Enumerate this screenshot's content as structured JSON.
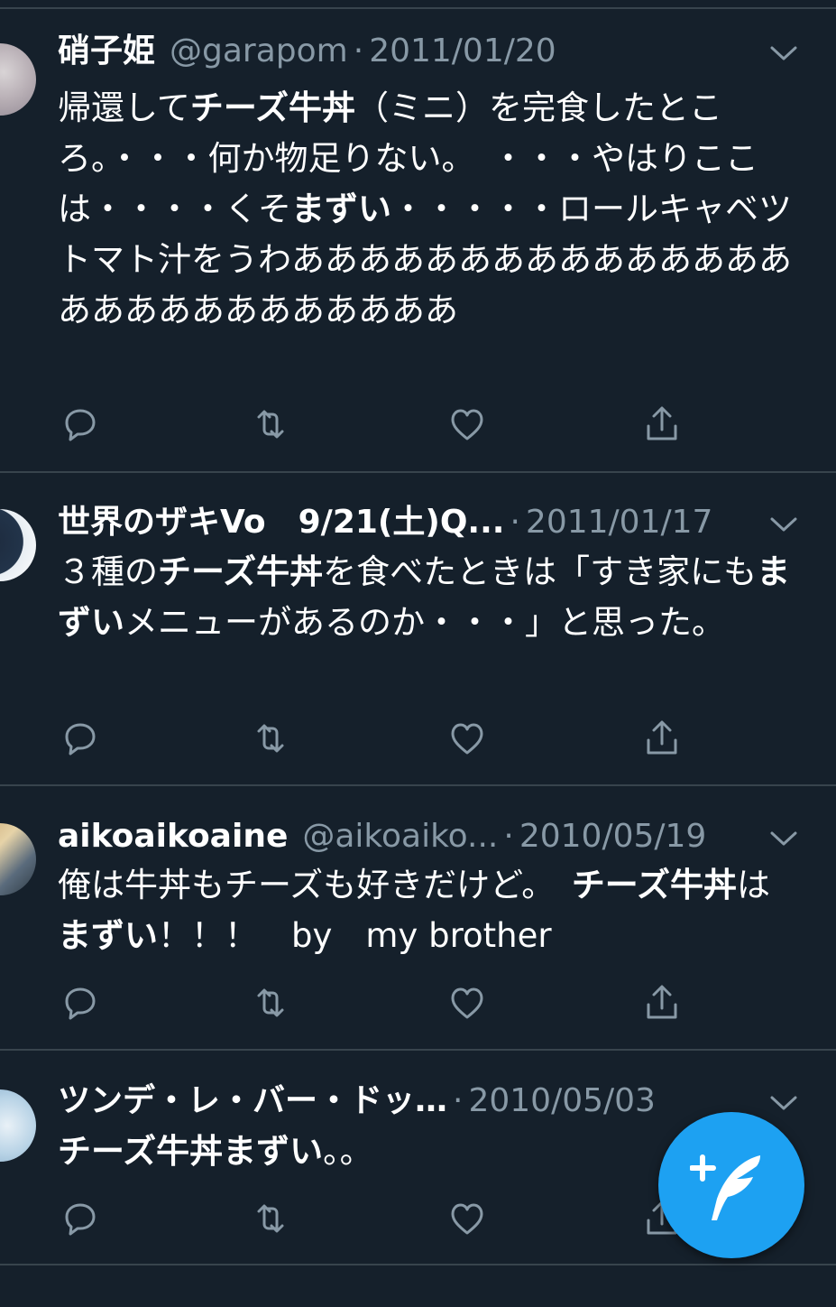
{
  "tweets": [
    {
      "name": "硝子姫",
      "handle": "@garapom",
      "date": "2011/01/20",
      "segments": [
        {
          "t": "帰還して",
          "b": false
        },
        {
          "t": "チーズ牛丼",
          "b": true
        },
        {
          "t": "（ミニ）を完食したところ。・・・何か物足りない。　・・・やはりここは・・・・くそ",
          "b": false
        },
        {
          "t": "まずい",
          "b": true
        },
        {
          "t": "・・・・・ロールキャベツトマト汁をうわあああああああああああああああああああああああああああ",
          "b": false
        }
      ]
    },
    {
      "name": "世界のザキVo　9/21(土)Q...",
      "handle": "",
      "date": "2011/01/17",
      "segments": [
        {
          "t": "３種の",
          "b": false
        },
        {
          "t": "チーズ牛丼",
          "b": true
        },
        {
          "t": "を食べたときは「すき家にも",
          "b": false
        },
        {
          "t": "まずい",
          "b": true
        },
        {
          "t": "メニューがあるのか・・・」と思った。",
          "b": false
        }
      ]
    },
    {
      "name": "aikoaikoaine",
      "handle": "@aikoaiko...",
      "date": "2010/05/19",
      "segments": [
        {
          "t": "俺は牛丼もチーズも好きだけど。　",
          "b": false
        },
        {
          "t": "チーズ牛丼",
          "b": true
        },
        {
          "t": "は",
          "b": false
        },
        {
          "t": "まずい",
          "b": true
        },
        {
          "t": "！！！　by　my brother",
          "b": false
        }
      ]
    },
    {
      "name": "ツンデ・レ・バー・ドッ…",
      "handle": "",
      "date": "2010/05/03",
      "segments": [
        {
          "t": "チーズ牛丼まずい",
          "b": true
        },
        {
          "t": "。。",
          "b": false
        }
      ]
    }
  ],
  "colors": {
    "background": "#15202b",
    "secondary_text": "#8899a6",
    "divider": "#38444d",
    "accent": "#1da1f2"
  },
  "icons": {
    "actions": [
      "reply-icon",
      "retweet-icon",
      "like-icon",
      "share-icon"
    ],
    "caret": "chevron-down-icon",
    "compose": "compose-tweet-icon"
  }
}
